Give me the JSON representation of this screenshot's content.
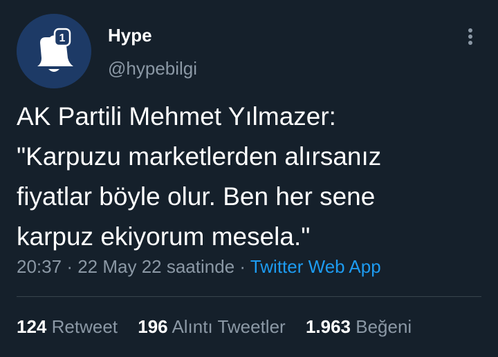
{
  "author": {
    "display_name": "Hype",
    "handle": "@hypebilgi",
    "avatar_badge": "1",
    "avatar_bg_color": "#1d3a66"
  },
  "tweet": {
    "text_lines": [
      "AK Partili Mehmet Yılmazer:",
      "\"Karpuzu marketlerden alırsanız",
      "fiyatlar böyle olur. Ben her sene",
      "karpuz ekiyorum mesela.\""
    ],
    "time": "20:37",
    "date": "22 May 22 saatinde",
    "separator": "·",
    "source": "Twitter Web App"
  },
  "stats": {
    "retweets": {
      "count": "124",
      "label": "Retweet"
    },
    "quotes": {
      "count": "196",
      "label": "Alıntı Tweetler"
    },
    "likes": {
      "count": "1.963",
      "label": "Beğeni"
    }
  },
  "icons": {
    "more": "more-vertical-icon",
    "avatar": "bell-logo-icon"
  },
  "colors": {
    "background": "#15202b",
    "text": "#ffffff",
    "secondary": "#8b98a5",
    "link": "#1d9bf0",
    "divider": "#38444d"
  }
}
